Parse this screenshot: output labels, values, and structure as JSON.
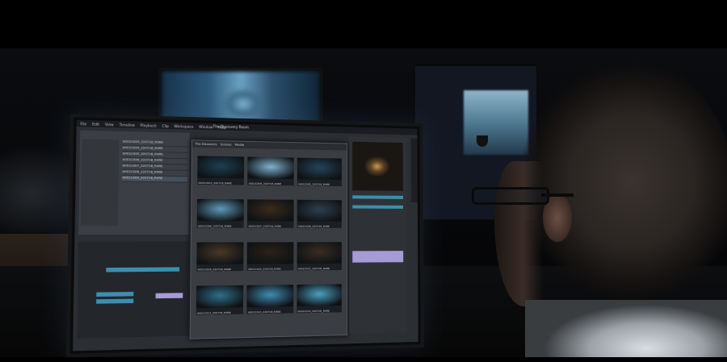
{
  "screen": {
    "menu": [
      "File",
      "Edit",
      "View",
      "Timeline",
      "Playback",
      "Clip",
      "Workspace",
      "Window",
      "Help"
    ],
    "project_title": "The Discovery Room",
    "breadcrumbs": [
      "The Discovery",
      "Scenes",
      "Media"
    ],
    "files": [
      "A001C003_220718_R4RE",
      "A001C004_220718_R4RE",
      "A001C005_220718_R4RE",
      "A001C006_220718_R4RE",
      "A001C007_220718_R4RE",
      "A001C008_220718_R4RE",
      "A001C009_220718_R4RE"
    ],
    "thumbnails": [
      {
        "label": "A001C003_220718_R4RE",
        "color": "#1d3f52"
      },
      {
        "label": "A001C004_220718_R4RE",
        "color": "#7fb2d0"
      },
      {
        "label": "A001C005_220718_R4RE",
        "color": "#24445a"
      },
      {
        "label": "A001C006_220718_R4RE",
        "color": "#5f9ab8"
      },
      {
        "label": "A001C007_220718_R4RE",
        "color": "#3a2a1c"
      },
      {
        "label": "A001C008_220718_R4RE",
        "color": "#2f3f50"
      },
      {
        "label": "A001C009_220718_R4RE",
        "color": "#4a3826"
      },
      {
        "label": "A001C010_220718_R4RE",
        "color": "#2b2118"
      },
      {
        "label": "A001C011_220718_R4RE",
        "color": "#3a2c22"
      },
      {
        "label": "A001C012_220718_R4RE",
        "color": "#2f6f8a"
      },
      {
        "label": "A001C013_220718_R4RE",
        "color": "#3e8db0"
      },
      {
        "label": "A001C014_220718_R4RE",
        "color": "#4aa0c0"
      }
    ],
    "accent_color": "#3a8fb0",
    "clip_color": "#a79bd6"
  }
}
